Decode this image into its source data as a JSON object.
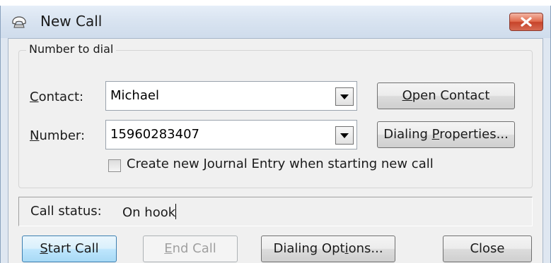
{
  "window": {
    "title": "New Call"
  },
  "group": {
    "legend": "Number to dial"
  },
  "contact": {
    "label_pre": "",
    "label_accel": "C",
    "label_post": "ontact:",
    "value": "Michael"
  },
  "number": {
    "label_pre": "",
    "label_accel": "N",
    "label_post": "umber:",
    "value": "15960283407"
  },
  "buttons": {
    "open_contact": {
      "pre": "",
      "accel": "O",
      "post": "pen Contact"
    },
    "dialing_properties": {
      "pre": "Dialing ",
      "accel": "P",
      "post": "roperties..."
    },
    "start_call": {
      "pre": "",
      "accel": "S",
      "post": "tart Call"
    },
    "end_call": {
      "pre": "",
      "accel": "E",
      "post": "nd Call"
    },
    "dialing_options": {
      "pre": "Dialing Opt",
      "accel": "i",
      "post": "ons..."
    },
    "close": {
      "label": "Close"
    }
  },
  "journal": {
    "pre": "Create new ",
    "accel": "J",
    "post": "ournal Entry when starting new call",
    "checked": false
  },
  "status": {
    "label": "Call status:",
    "value": "On hook"
  }
}
